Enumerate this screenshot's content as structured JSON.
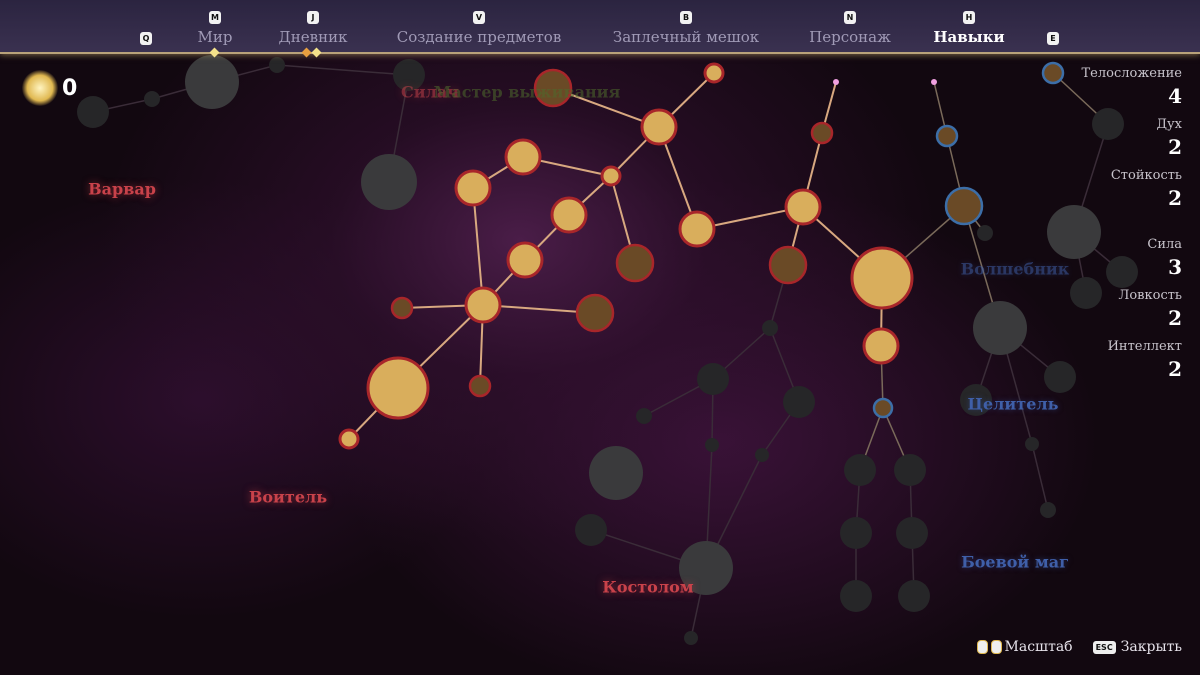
{
  "nav": {
    "prev_key": "Q",
    "next_key": "E",
    "tabs": [
      {
        "label": "Мир",
        "key": "M"
      },
      {
        "label": "Дневник",
        "key": "J"
      },
      {
        "label": "Создание предметов",
        "key": "V"
      },
      {
        "label": "Заплечный мешок",
        "key": "B"
      },
      {
        "label": "Персонаж",
        "key": "N"
      },
      {
        "label": "Навыки",
        "key": "H",
        "active": true
      }
    ]
  },
  "skill_points": "0",
  "tree_labels": {
    "barbarian": "Варвар",
    "warrior": "Воитель",
    "bonebreaker": "Костолом",
    "strongman": "Силач",
    "survival_master": "Мастер выживания",
    "wizard": "Волшебник",
    "healer": "Целитель",
    "battle_mage": "Боевой маг"
  },
  "stats": [
    {
      "name": "Телосложение",
      "value": "4"
    },
    {
      "name": "Дух",
      "value": "2"
    },
    {
      "name": "Стойкость",
      "value": "2"
    },
    {
      "name": "Сила",
      "value": "3"
    },
    {
      "name": "Ловкость",
      "value": "2"
    },
    {
      "name": "Интеллект",
      "value": "2"
    }
  ],
  "hints": {
    "zoom": "Масштаб",
    "close_key": "ESC",
    "close": "Закрыть"
  },
  "colors": {
    "active": "#e0b860",
    "ring_red": "#a8262a",
    "ring_blue": "#3c6ea8",
    "locked": "#2a2a2c"
  }
}
